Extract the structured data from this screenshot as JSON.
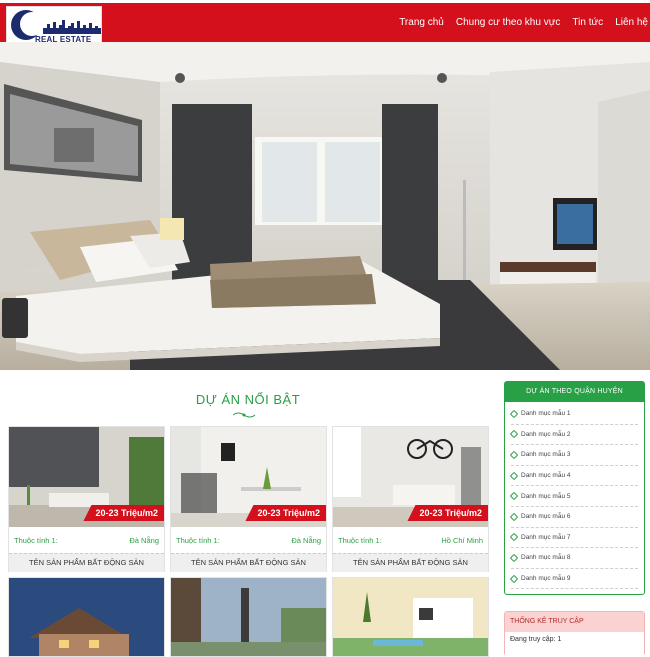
{
  "brand": {
    "logo_text": "REAL ESTATE"
  },
  "nav": [
    {
      "label": "Trang chủ"
    },
    {
      "label": "Chung cư theo khu vực"
    },
    {
      "label": "Tin tức"
    },
    {
      "label": "Liên hệ"
    }
  ],
  "featured": {
    "title": "DỰ ÁN NỔI BẬT",
    "cards": [
      {
        "price": "20-23 Triệu/m2",
        "attr_label": "Thuộc tính 1:",
        "attr_value": "Đà Nẵng",
        "name": "TÊN SẢN PHẨM BẤT ĐỘNG SẢN"
      },
      {
        "price": "20-23 Triệu/m2",
        "attr_label": "Thuộc tính 1:",
        "attr_value": "Đà Nẵng",
        "name": "TÊN SẢN PHẨM BẤT ĐỘNG SẢN"
      },
      {
        "price": "20-23 Triệu/m2",
        "attr_label": "Thuộc tính 1:",
        "attr_value": "Hồ Chí Minh",
        "name": "TÊN SẢN PHẨM BẤT ĐỘNG SẢN"
      }
    ]
  },
  "sidebar": {
    "district_title": "DỰ ÁN THEO QUẬN HUYỆN",
    "items": [
      {
        "label": "Danh mục mẫu 1"
      },
      {
        "label": "Danh mục mẫu 2"
      },
      {
        "label": "Danh mục mẫu 3"
      },
      {
        "label": "Danh mục mẫu 4"
      },
      {
        "label": "Danh mục mẫu 5"
      },
      {
        "label": "Danh mục mẫu 6"
      },
      {
        "label": "Danh mục mẫu 7"
      },
      {
        "label": "Danh mục mẫu 8"
      },
      {
        "label": "Danh mục mẫu 9"
      }
    ],
    "stats_title": "THỐNG KÊ TRUY CẬP",
    "stats_online": "Đang truy cập: 1"
  },
  "colors": {
    "header": "#d3101c",
    "accent_green": "#27a046",
    "price_red": "#d3101c"
  }
}
